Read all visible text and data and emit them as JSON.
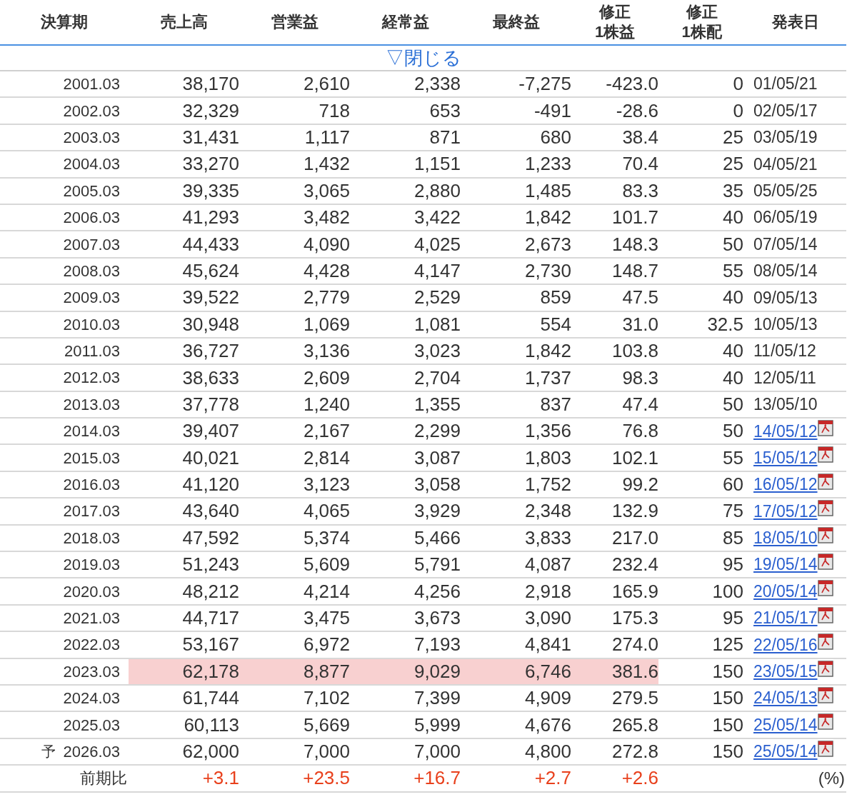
{
  "columns": [
    [
      "決算期"
    ],
    [
      "売上高"
    ],
    [
      "営業益"
    ],
    [
      "経常益"
    ],
    [
      "最終益"
    ],
    [
      "修正",
      "1株益"
    ],
    [
      "修正",
      "1株配"
    ],
    [
      "発表日"
    ]
  ],
  "toggle": "▽閉じる",
  "rows": [
    {
      "period": "2001.03",
      "values": [
        "38,170",
        "2,610",
        "2,338",
        "-7,275",
        "-423.0",
        "0"
      ],
      "date": "01/05/21",
      "linked": false,
      "highlighted": false
    },
    {
      "period": "2002.03",
      "values": [
        "32,329",
        "718",
        "653",
        "-491",
        "-28.6",
        "0"
      ],
      "date": "02/05/17",
      "linked": false,
      "highlighted": false
    },
    {
      "period": "2003.03",
      "values": [
        "31,431",
        "1,117",
        "871",
        "680",
        "38.4",
        "25"
      ],
      "date": "03/05/19",
      "linked": false,
      "highlighted": false
    },
    {
      "period": "2004.03",
      "values": [
        "33,270",
        "1,432",
        "1,151",
        "1,233",
        "70.4",
        "25"
      ],
      "date": "04/05/21",
      "linked": false,
      "highlighted": false
    },
    {
      "period": "2005.03",
      "values": [
        "39,335",
        "3,065",
        "2,880",
        "1,485",
        "83.3",
        "35"
      ],
      "date": "05/05/25",
      "linked": false,
      "highlighted": false
    },
    {
      "period": "2006.03",
      "values": [
        "41,293",
        "3,482",
        "3,422",
        "1,842",
        "101.7",
        "40"
      ],
      "date": "06/05/19",
      "linked": false,
      "highlighted": false
    },
    {
      "period": "2007.03",
      "values": [
        "44,433",
        "4,090",
        "4,025",
        "2,673",
        "148.3",
        "50"
      ],
      "date": "07/05/14",
      "linked": false,
      "highlighted": false
    },
    {
      "period": "2008.03",
      "values": [
        "45,624",
        "4,428",
        "4,147",
        "2,730",
        "148.7",
        "55"
      ],
      "date": "08/05/14",
      "linked": false,
      "highlighted": false
    },
    {
      "period": "2009.03",
      "values": [
        "39,522",
        "2,779",
        "2,529",
        "859",
        "47.5",
        "40"
      ],
      "date": "09/05/13",
      "linked": false,
      "highlighted": false
    },
    {
      "period": "2010.03",
      "values": [
        "30,948",
        "1,069",
        "1,081",
        "554",
        "31.0",
        "32.5"
      ],
      "date": "10/05/13",
      "linked": false,
      "highlighted": false
    },
    {
      "period": "2011.03",
      "values": [
        "36,727",
        "3,136",
        "3,023",
        "1,842",
        "103.8",
        "40"
      ],
      "date": "11/05/12",
      "linked": false,
      "highlighted": false
    },
    {
      "period": "2012.03",
      "values": [
        "38,633",
        "2,609",
        "2,704",
        "1,737",
        "98.3",
        "40"
      ],
      "date": "12/05/11",
      "linked": false,
      "highlighted": false
    },
    {
      "period": "2013.03",
      "values": [
        "37,778",
        "1,240",
        "1,355",
        "837",
        "47.4",
        "50"
      ],
      "date": "13/05/10",
      "linked": false,
      "highlighted": false
    },
    {
      "period": "2014.03",
      "values": [
        "39,407",
        "2,167",
        "2,299",
        "1,356",
        "76.8",
        "50"
      ],
      "date": "14/05/12",
      "linked": true,
      "highlighted": false
    },
    {
      "period": "2015.03",
      "values": [
        "40,021",
        "2,814",
        "3,087",
        "1,803",
        "102.1",
        "55"
      ],
      "date": "15/05/12",
      "linked": true,
      "highlighted": false
    },
    {
      "period": "2016.03",
      "values": [
        "41,120",
        "3,123",
        "3,058",
        "1,752",
        "99.2",
        "60"
      ],
      "date": "16/05/12",
      "linked": true,
      "highlighted": false
    },
    {
      "period": "2017.03",
      "values": [
        "43,640",
        "4,065",
        "3,929",
        "2,348",
        "132.9",
        "75"
      ],
      "date": "17/05/12",
      "linked": true,
      "highlighted": false
    },
    {
      "period": "2018.03",
      "values": [
        "47,592",
        "5,374",
        "5,466",
        "3,833",
        "217.0",
        "85"
      ],
      "date": "18/05/10",
      "linked": true,
      "highlighted": false
    },
    {
      "period": "2019.03",
      "values": [
        "51,243",
        "5,609",
        "5,791",
        "4,087",
        "232.4",
        "95"
      ],
      "date": "19/05/14",
      "linked": true,
      "highlighted": false
    },
    {
      "period": "2020.03",
      "values": [
        "48,212",
        "4,214",
        "4,256",
        "2,918",
        "165.9",
        "100"
      ],
      "date": "20/05/14",
      "linked": true,
      "highlighted": false
    },
    {
      "period": "2021.03",
      "values": [
        "44,717",
        "3,475",
        "3,673",
        "3,090",
        "175.3",
        "95"
      ],
      "date": "21/05/17",
      "linked": true,
      "highlighted": false
    },
    {
      "period": "2022.03",
      "values": [
        "53,167",
        "6,972",
        "7,193",
        "4,841",
        "274.0",
        "125"
      ],
      "date": "22/05/16",
      "linked": true,
      "highlighted": false
    },
    {
      "period": "2023.03",
      "values": [
        "62,178",
        "8,877",
        "9,029",
        "6,746",
        "381.6",
        "150"
      ],
      "date": "23/05/15",
      "linked": true,
      "highlighted": true
    },
    {
      "period": "2024.03",
      "values": [
        "61,744",
        "7,102",
        "7,399",
        "4,909",
        "279.5",
        "150"
      ],
      "date": "24/05/13",
      "linked": true,
      "highlighted": false
    },
    {
      "period": "2025.03",
      "values": [
        "60,113",
        "5,669",
        "5,999",
        "4,676",
        "265.8",
        "150"
      ],
      "date": "25/05/14",
      "linked": true,
      "highlighted": false
    },
    {
      "period": "2026.03",
      "prefix": "予",
      "values": [
        "62,000",
        "7,000",
        "7,000",
        "4,800",
        "272.8",
        "150"
      ],
      "date": "25/05/14",
      "linked": true,
      "highlighted": false
    }
  ],
  "change_row": {
    "label": "前期比",
    "values": [
      "+3.1",
      "+23.5",
      "+16.7",
      "+2.7",
      "+2.6"
    ],
    "unit": "(%)"
  }
}
